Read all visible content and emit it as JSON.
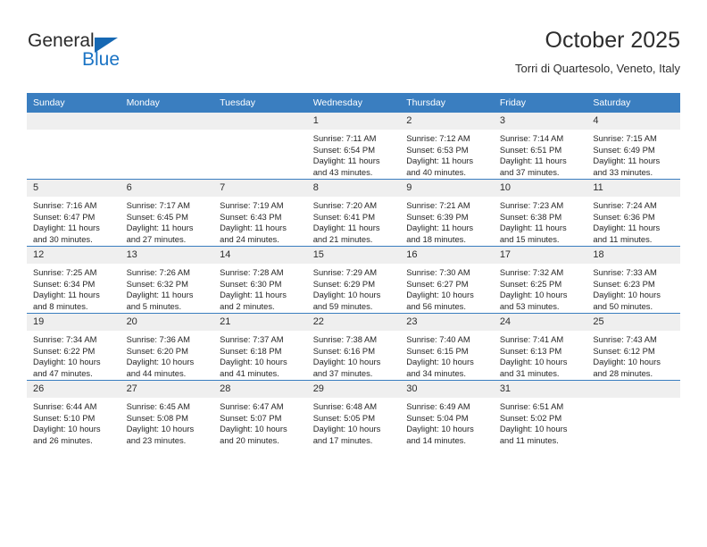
{
  "brand": {
    "name_top": "General",
    "name_bottom": "Blue",
    "triangle_color": "#1668b3",
    "blue_color": "#1a73c4"
  },
  "header": {
    "title": "October 2025",
    "subtitle": "Torri di Quartesolo, Veneto, Italy"
  },
  "theme": {
    "header_bg": "#3a7ec0",
    "header_text": "#ffffff",
    "daynum_bg": "#efefef",
    "cell_bg": "#ffffff",
    "row_border": "#3a7ec0"
  },
  "weekdays": [
    "Sunday",
    "Monday",
    "Tuesday",
    "Wednesday",
    "Thursday",
    "Friday",
    "Saturday"
  ],
  "labels": {
    "sunrise_prefix": "Sunrise:",
    "sunset_prefix": "Sunset:",
    "daylight_prefix": "Daylight:"
  },
  "weeks": [
    [
      {
        "day": "",
        "sunrise": "",
        "sunset": "",
        "daylight": ""
      },
      {
        "day": "",
        "sunrise": "",
        "sunset": "",
        "daylight": ""
      },
      {
        "day": "",
        "sunrise": "",
        "sunset": "",
        "daylight": ""
      },
      {
        "day": "1",
        "sunrise": "Sunrise: 7:11 AM",
        "sunset": "Sunset: 6:54 PM",
        "daylight": "Daylight: 11 hours and 43 minutes."
      },
      {
        "day": "2",
        "sunrise": "Sunrise: 7:12 AM",
        "sunset": "Sunset: 6:53 PM",
        "daylight": "Daylight: 11 hours and 40 minutes."
      },
      {
        "day": "3",
        "sunrise": "Sunrise: 7:14 AM",
        "sunset": "Sunset: 6:51 PM",
        "daylight": "Daylight: 11 hours and 37 minutes."
      },
      {
        "day": "4",
        "sunrise": "Sunrise: 7:15 AM",
        "sunset": "Sunset: 6:49 PM",
        "daylight": "Daylight: 11 hours and 33 minutes."
      }
    ],
    [
      {
        "day": "5",
        "sunrise": "Sunrise: 7:16 AM",
        "sunset": "Sunset: 6:47 PM",
        "daylight": "Daylight: 11 hours and 30 minutes."
      },
      {
        "day": "6",
        "sunrise": "Sunrise: 7:17 AM",
        "sunset": "Sunset: 6:45 PM",
        "daylight": "Daylight: 11 hours and 27 minutes."
      },
      {
        "day": "7",
        "sunrise": "Sunrise: 7:19 AM",
        "sunset": "Sunset: 6:43 PM",
        "daylight": "Daylight: 11 hours and 24 minutes."
      },
      {
        "day": "8",
        "sunrise": "Sunrise: 7:20 AM",
        "sunset": "Sunset: 6:41 PM",
        "daylight": "Daylight: 11 hours and 21 minutes."
      },
      {
        "day": "9",
        "sunrise": "Sunrise: 7:21 AM",
        "sunset": "Sunset: 6:39 PM",
        "daylight": "Daylight: 11 hours and 18 minutes."
      },
      {
        "day": "10",
        "sunrise": "Sunrise: 7:23 AM",
        "sunset": "Sunset: 6:38 PM",
        "daylight": "Daylight: 11 hours and 15 minutes."
      },
      {
        "day": "11",
        "sunrise": "Sunrise: 7:24 AM",
        "sunset": "Sunset: 6:36 PM",
        "daylight": "Daylight: 11 hours and 11 minutes."
      }
    ],
    [
      {
        "day": "12",
        "sunrise": "Sunrise: 7:25 AM",
        "sunset": "Sunset: 6:34 PM",
        "daylight": "Daylight: 11 hours and 8 minutes."
      },
      {
        "day": "13",
        "sunrise": "Sunrise: 7:26 AM",
        "sunset": "Sunset: 6:32 PM",
        "daylight": "Daylight: 11 hours and 5 minutes."
      },
      {
        "day": "14",
        "sunrise": "Sunrise: 7:28 AM",
        "sunset": "Sunset: 6:30 PM",
        "daylight": "Daylight: 11 hours and 2 minutes."
      },
      {
        "day": "15",
        "sunrise": "Sunrise: 7:29 AM",
        "sunset": "Sunset: 6:29 PM",
        "daylight": "Daylight: 10 hours and 59 minutes."
      },
      {
        "day": "16",
        "sunrise": "Sunrise: 7:30 AM",
        "sunset": "Sunset: 6:27 PM",
        "daylight": "Daylight: 10 hours and 56 minutes."
      },
      {
        "day": "17",
        "sunrise": "Sunrise: 7:32 AM",
        "sunset": "Sunset: 6:25 PM",
        "daylight": "Daylight: 10 hours and 53 minutes."
      },
      {
        "day": "18",
        "sunrise": "Sunrise: 7:33 AM",
        "sunset": "Sunset: 6:23 PM",
        "daylight": "Daylight: 10 hours and 50 minutes."
      }
    ],
    [
      {
        "day": "19",
        "sunrise": "Sunrise: 7:34 AM",
        "sunset": "Sunset: 6:22 PM",
        "daylight": "Daylight: 10 hours and 47 minutes."
      },
      {
        "day": "20",
        "sunrise": "Sunrise: 7:36 AM",
        "sunset": "Sunset: 6:20 PM",
        "daylight": "Daylight: 10 hours and 44 minutes."
      },
      {
        "day": "21",
        "sunrise": "Sunrise: 7:37 AM",
        "sunset": "Sunset: 6:18 PM",
        "daylight": "Daylight: 10 hours and 41 minutes."
      },
      {
        "day": "22",
        "sunrise": "Sunrise: 7:38 AM",
        "sunset": "Sunset: 6:16 PM",
        "daylight": "Daylight: 10 hours and 37 minutes."
      },
      {
        "day": "23",
        "sunrise": "Sunrise: 7:40 AM",
        "sunset": "Sunset: 6:15 PM",
        "daylight": "Daylight: 10 hours and 34 minutes."
      },
      {
        "day": "24",
        "sunrise": "Sunrise: 7:41 AM",
        "sunset": "Sunset: 6:13 PM",
        "daylight": "Daylight: 10 hours and 31 minutes."
      },
      {
        "day": "25",
        "sunrise": "Sunrise: 7:43 AM",
        "sunset": "Sunset: 6:12 PM",
        "daylight": "Daylight: 10 hours and 28 minutes."
      }
    ],
    [
      {
        "day": "26",
        "sunrise": "Sunrise: 6:44 AM",
        "sunset": "Sunset: 5:10 PM",
        "daylight": "Daylight: 10 hours and 26 minutes."
      },
      {
        "day": "27",
        "sunrise": "Sunrise: 6:45 AM",
        "sunset": "Sunset: 5:08 PM",
        "daylight": "Daylight: 10 hours and 23 minutes."
      },
      {
        "day": "28",
        "sunrise": "Sunrise: 6:47 AM",
        "sunset": "Sunset: 5:07 PM",
        "daylight": "Daylight: 10 hours and 20 minutes."
      },
      {
        "day": "29",
        "sunrise": "Sunrise: 6:48 AM",
        "sunset": "Sunset: 5:05 PM",
        "daylight": "Daylight: 10 hours and 17 minutes."
      },
      {
        "day": "30",
        "sunrise": "Sunrise: 6:49 AM",
        "sunset": "Sunset: 5:04 PM",
        "daylight": "Daylight: 10 hours and 14 minutes."
      },
      {
        "day": "31",
        "sunrise": "Sunrise: 6:51 AM",
        "sunset": "Sunset: 5:02 PM",
        "daylight": "Daylight: 10 hours and 11 minutes."
      },
      {
        "day": "",
        "sunrise": "",
        "sunset": "",
        "daylight": ""
      }
    ]
  ]
}
